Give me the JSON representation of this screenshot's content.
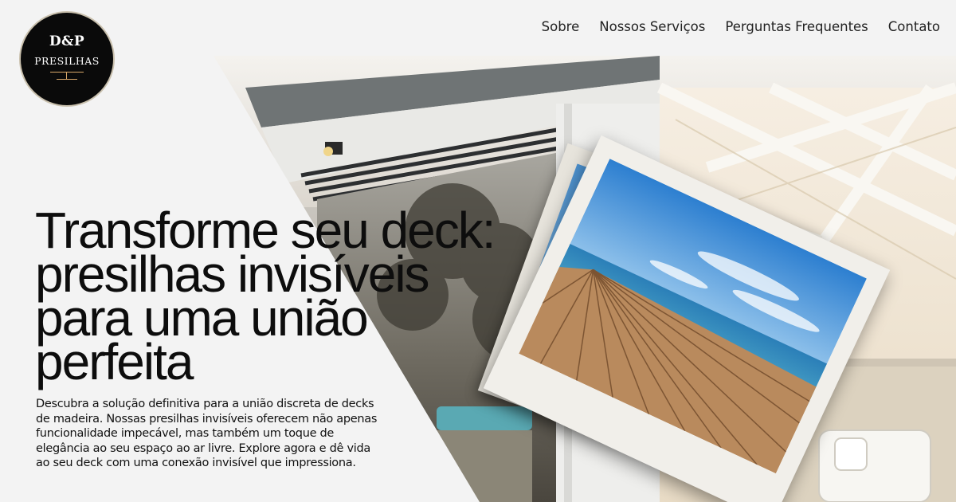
{
  "brand": {
    "line1": "D&P",
    "line2": "PRESILHAS",
    "colors": {
      "badge": "#0a0a0a",
      "accent": "#d9a86a"
    }
  },
  "nav": {
    "items": [
      {
        "label": "Sobre"
      },
      {
        "label": "Nossos Serviços"
      },
      {
        "label": "Perguntas Frequentes"
      },
      {
        "label": "Contato"
      }
    ]
  },
  "hero": {
    "headline": "Transforme seu deck: presilhas invisíveis para uma união perfeita",
    "description": "Descubra a solução definitiva para a união discreta de decks de madeira. Nossas presilhas invisíveis oferecem não apenas funcionalidade impecável, mas também um toque de elegância ao seu espaço ao ar livre. Explore agora e dê vida ao seu deck com uma conexão invisível que impressiona."
  }
}
